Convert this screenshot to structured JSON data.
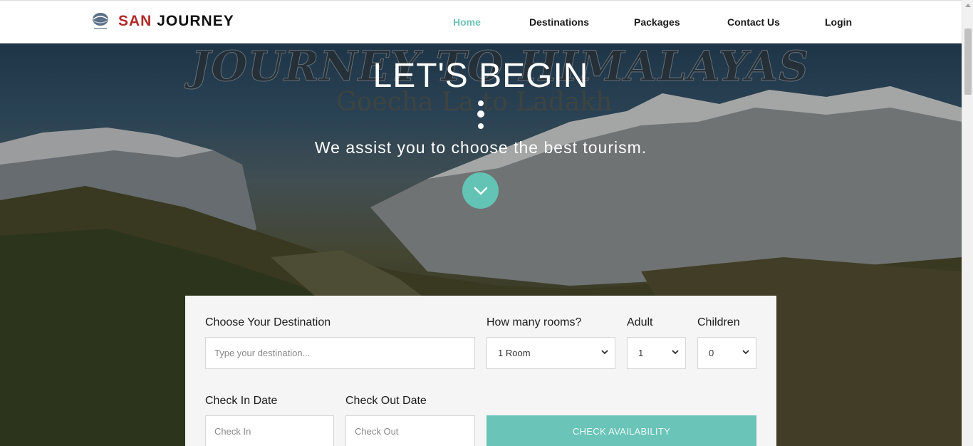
{
  "brand": {
    "name_first": "SAN",
    "name_rest": "JOURNEY"
  },
  "nav": {
    "items": [
      {
        "label": "Home",
        "active": true
      },
      {
        "label": "Destinations",
        "active": false
      },
      {
        "label": "Packages",
        "active": false
      },
      {
        "label": "Contact Us",
        "active": false
      },
      {
        "label": "Login",
        "active": false
      }
    ]
  },
  "hero": {
    "title": "LET'S BEGIN",
    "subtitle": "We assist you to choose the best tourism.",
    "watermark_title": "JOURNEY TO HIMALAYAS",
    "watermark_subtitle": "Goecha La to Ladakh",
    "scroll_icon": "chevron-down-icon"
  },
  "booking": {
    "destination_label": "Choose Your Destination",
    "destination_placeholder": "Type your destination...",
    "rooms_label": "How many rooms?",
    "rooms_value": "1 Room",
    "adult_label": "Adult",
    "adult_value": "1",
    "children_label": "Children",
    "children_value": "0",
    "checkin_label": "Check In Date",
    "checkin_placeholder": "Check In",
    "checkout_label": "Check Out Date",
    "checkout_placeholder": "Check Out",
    "check_button": "CHECK AVAILABILITY"
  },
  "colors": {
    "accent": "#63c3b5",
    "brand_red": "#b02a2a",
    "nav_active": "#6fc3b7"
  }
}
